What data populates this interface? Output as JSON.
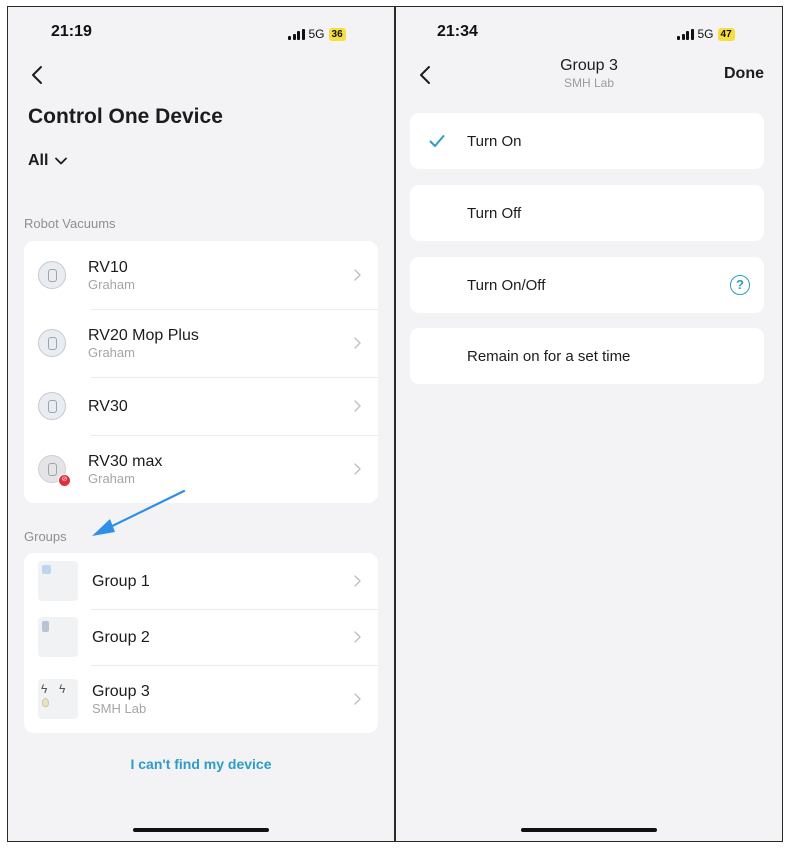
{
  "left_screen": {
    "status": {
      "time": "21:19",
      "network": "5G",
      "battery": "36"
    },
    "title": "Control One Device",
    "filter_label": "All",
    "sections": {
      "robot_vacuums": "Robot Vacuums",
      "groups": "Groups"
    },
    "vacuums": [
      {
        "name": "RV10",
        "owner": "Graham",
        "status_badge": false
      },
      {
        "name": "RV20 Mop Plus",
        "owner": "Graham",
        "status_badge": false
      },
      {
        "name": "RV30",
        "owner": "",
        "status_badge": false
      },
      {
        "name": "RV30 max",
        "owner": "Graham",
        "status_badge": true
      }
    ],
    "groups": [
      {
        "name": "Group 1",
        "location": "",
        "icon": "plug-icon"
      },
      {
        "name": "Group 2",
        "location": "",
        "icon": "sensor-icon"
      },
      {
        "name": "Group 3",
        "location": "SMH Lab",
        "icon": "switch-bulb-icon"
      }
    ],
    "find_link": "I can't find my device"
  },
  "right_screen": {
    "status": {
      "time": "21:34",
      "network": "5G",
      "battery": "47"
    },
    "nav_title": "Group 3",
    "nav_subtitle": "SMH Lab",
    "done_label": "Done",
    "options": [
      {
        "label": "Turn On",
        "selected": true,
        "help": false
      },
      {
        "label": "Turn Off",
        "selected": false,
        "help": false
      },
      {
        "label": "Turn On/Off",
        "selected": false,
        "help": true
      },
      {
        "label": "Remain on for a set time",
        "selected": false,
        "help": false
      }
    ]
  },
  "colors": {
    "accent": "#2d9cc6",
    "background": "#f3f3f5",
    "card": "#ffffff",
    "battery_badge": "#f7dd3f",
    "offline_badge": "#e0303a",
    "annotation_arrow": "#2f8ee6"
  }
}
